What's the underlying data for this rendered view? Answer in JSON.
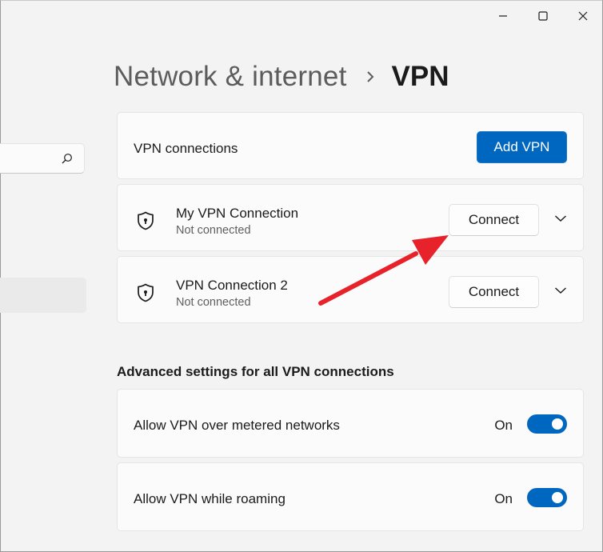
{
  "window": {
    "controls": [
      "minimize-icon",
      "maximize-icon",
      "close-icon"
    ]
  },
  "sidebar": {
    "search_icon": "search-icon"
  },
  "breadcrumb": {
    "parent": "Network & internet",
    "separator_icon": "chevron-right-icon",
    "current": "VPN"
  },
  "vpn": {
    "header_label": "VPN connections",
    "add_button": "Add VPN",
    "connections": [
      {
        "name": "My VPN Connection",
        "status": "Not connected",
        "action": "Connect",
        "icon": "shield-icon"
      },
      {
        "name": "VPN Connection 2",
        "status": "Not connected",
        "action": "Connect",
        "icon": "shield-icon"
      }
    ]
  },
  "advanced": {
    "title": "Advanced settings for all VPN connections",
    "settings": [
      {
        "label": "Allow VPN over metered networks",
        "state": "On",
        "enabled": true
      },
      {
        "label": "Allow VPN while roaming",
        "state": "On",
        "enabled": true
      }
    ]
  },
  "colors": {
    "accent": "#0067c0",
    "annotation_arrow": "#e8222b"
  }
}
